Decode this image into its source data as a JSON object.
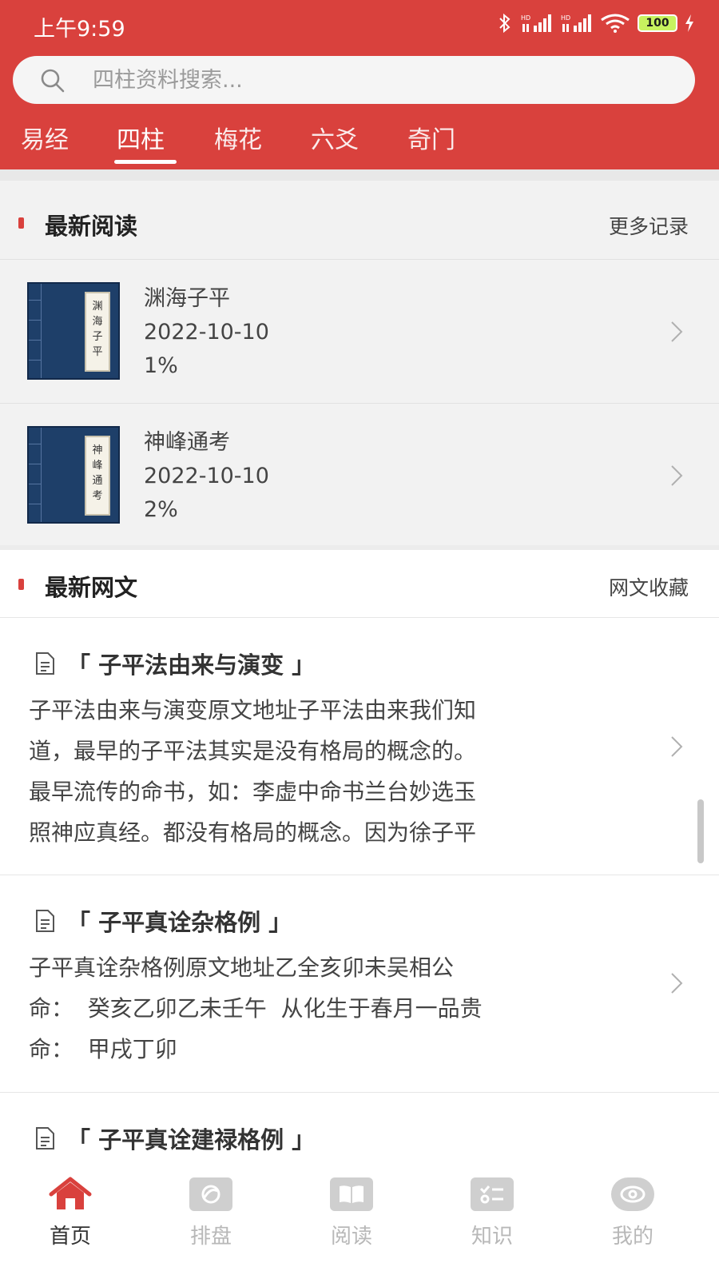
{
  "status_bar": {
    "time": "上午9:59",
    "battery": "100"
  },
  "search": {
    "placeholder": "四柱资料搜索..."
  },
  "tabs": [
    {
      "label": "易经"
    },
    {
      "label": "四柱",
      "active": true
    },
    {
      "label": "梅花"
    },
    {
      "label": "六爻"
    },
    {
      "label": "奇门"
    }
  ],
  "recent_reading": {
    "title": "最新阅读",
    "more_label": "更多记录",
    "items": [
      {
        "name": "渊海子平",
        "date": "2022-10-10",
        "progress": "1%",
        "cover_text": "渊海子平"
      },
      {
        "name": "神峰通考",
        "date": "2022-10-10",
        "progress": "2%",
        "cover_text": "神峰通考"
      }
    ]
  },
  "latest_articles": {
    "title": "最新网文",
    "more_label": "网文收藏",
    "items": [
      {
        "title": "「 子平法由来与演变 」",
        "lines": [
          "子平法由来与演变原文地址子平法由来我们知",
          "道，最早的子平法其实是没有格局的概念的。",
          "最早流传的命书，如：李虚中命书兰台妙选玉",
          "照神应真经。都没有格局的概念。因为徐子平"
        ]
      },
      {
        "title": "「 子平真诠杂格例 」",
        "lines": [
          "子平真诠杂格例原文地址乙全亥卯未吴相公",
          "命：  癸亥乙卯乙未壬午  从化生于春月一品贵",
          "命：  甲戌丁卯"
        ]
      },
      {
        "title": "「 子平真诠建禄格例 」",
        "lines": []
      }
    ]
  },
  "bottom_nav": [
    {
      "label": "首页",
      "icon": "home-icon",
      "active": true
    },
    {
      "label": "排盘",
      "icon": "chart-icon"
    },
    {
      "label": "阅读",
      "icon": "book-icon"
    },
    {
      "label": "知识",
      "icon": "checklist-icon"
    },
    {
      "label": "我的",
      "icon": "eye-icon"
    }
  ],
  "colors": {
    "accent": "#d9413d"
  }
}
